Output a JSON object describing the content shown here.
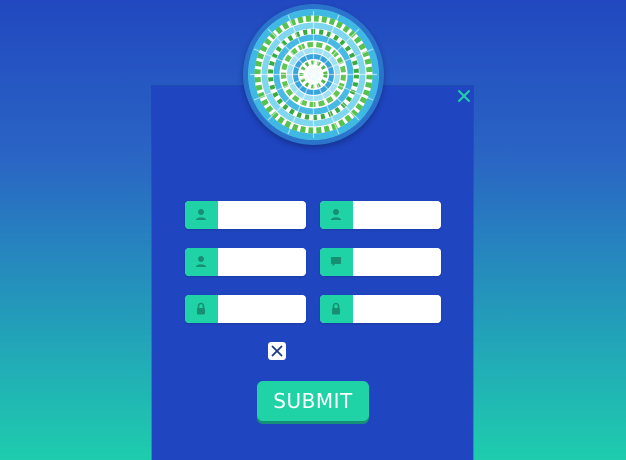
{
  "colors": {
    "background_top": "#2148c0",
    "background_bottom": "#1ecdad",
    "panel": "#1f45c0",
    "accent": "#20d3a6",
    "close_icon": "#21d0a8"
  },
  "avatar": {
    "icon": "tie-dye-avatar-image"
  },
  "close": {
    "icon": "close-icon"
  },
  "form": {
    "fields": [
      {
        "icon": "user-icon",
        "value": "",
        "placeholder": ""
      },
      {
        "icon": "user-icon",
        "value": "",
        "placeholder": ""
      },
      {
        "icon": "user-icon",
        "value": "",
        "placeholder": ""
      },
      {
        "icon": "chat-icon",
        "value": "",
        "placeholder": ""
      },
      {
        "icon": "lock-icon",
        "value": "",
        "placeholder": ""
      },
      {
        "icon": "lock-icon",
        "value": "",
        "placeholder": ""
      }
    ],
    "checkbox": {
      "icon": "x-mark-icon"
    },
    "submit_label": "SUBMIT"
  }
}
